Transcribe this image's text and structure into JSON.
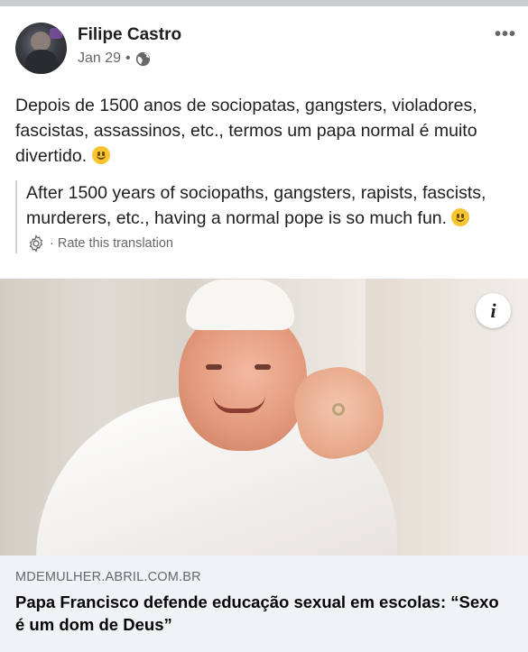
{
  "post": {
    "author": "Filipe Castro",
    "date": "Jan 29",
    "separator": "•",
    "privacy_icon": "globe-icon",
    "more_label": "•••",
    "text": "Depois de 1500 anos de sociopatas, gangsters, violadores, fascistas, assassinos, etc., termos um papa normal é muito divertido.",
    "translation": "After 1500 years of sociopaths, gangsters, rapists, fascists, murderers, etc., having a normal pope is so much fun.",
    "rate_label": "Rate this translation",
    "rate_separator": "·"
  },
  "link": {
    "domain": "MDEMULHER.ABRIL.COM.BR",
    "title": "Papa Francisco defende educação sexual em escolas: “Sexo é um dom de Deus”",
    "info_label": "i"
  },
  "colors": {
    "text": "#1c1e21",
    "secondary": "#65676b",
    "card_bg": "#f0f2f5"
  }
}
